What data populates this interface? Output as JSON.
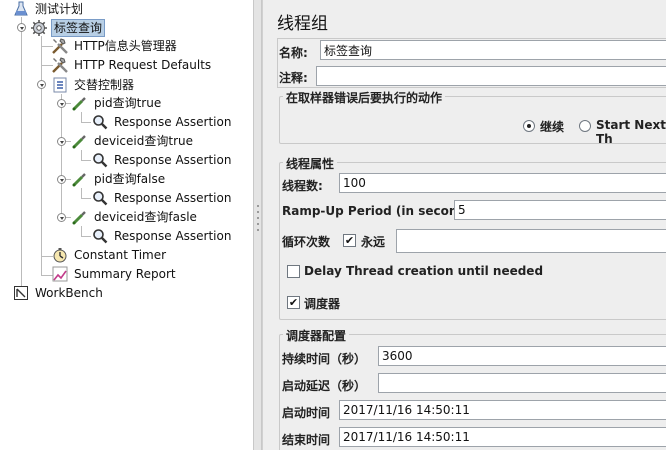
{
  "tree": {
    "test_plan": "测试计划",
    "thread_group": "标签查询",
    "header_manager": "HTTP信息头管理器",
    "request_defaults": "HTTP Request Defaults",
    "interleave_controller": "交替控制器",
    "samplers": [
      {
        "name": "pid查询true",
        "assertion": "Response Assertion"
      },
      {
        "name": "deviceid查询true",
        "assertion": "Response Assertion"
      },
      {
        "name": "pid查询false",
        "assertion": "Response Assertion"
      },
      {
        "name": "deviceid查询fasle",
        "assertion": "Response Assertion"
      }
    ],
    "constant_timer": "Constant Timer",
    "summary_report": "Summary Report",
    "workbench": "WorkBench"
  },
  "panel": {
    "title": "线程组",
    "name_label": "名称:",
    "name_value": "标签查询",
    "comment_label": "注释:",
    "comment_value": "",
    "on_error": {
      "title": "在取样器错误后要执行的动作",
      "continue_label": "继续",
      "continue_selected": true,
      "start_next_label": "Start Next Th",
      "start_next_selected": false
    },
    "thread_props": {
      "title": "线程属性",
      "num_threads_label": "线程数:",
      "num_threads_value": "100",
      "rampup_label": "Ramp-Up Period (in seconds):",
      "rampup_value": "5",
      "loop_label": "循环次数",
      "forever_label": "永远",
      "forever_checked": true,
      "loop_value": "",
      "delay_label": "Delay Thread creation until needed",
      "delay_checked": false,
      "scheduler_label": "调度器",
      "scheduler_checked": true
    },
    "scheduler": {
      "title": "调度器配置",
      "duration_label": "持续时间（秒）",
      "duration_value": "3600",
      "startup_delay_label": "启动延迟（秒）",
      "startup_delay_value": "",
      "start_time_label": "启动时间",
      "start_time_value": "2017/11/16 14:50:11",
      "end_time_label": "结束时间",
      "end_time_value": "2017/11/16 14:50:11"
    }
  },
  "colors": {
    "selection": "#b8cfe5",
    "panel_bg": "#eeeeee"
  }
}
